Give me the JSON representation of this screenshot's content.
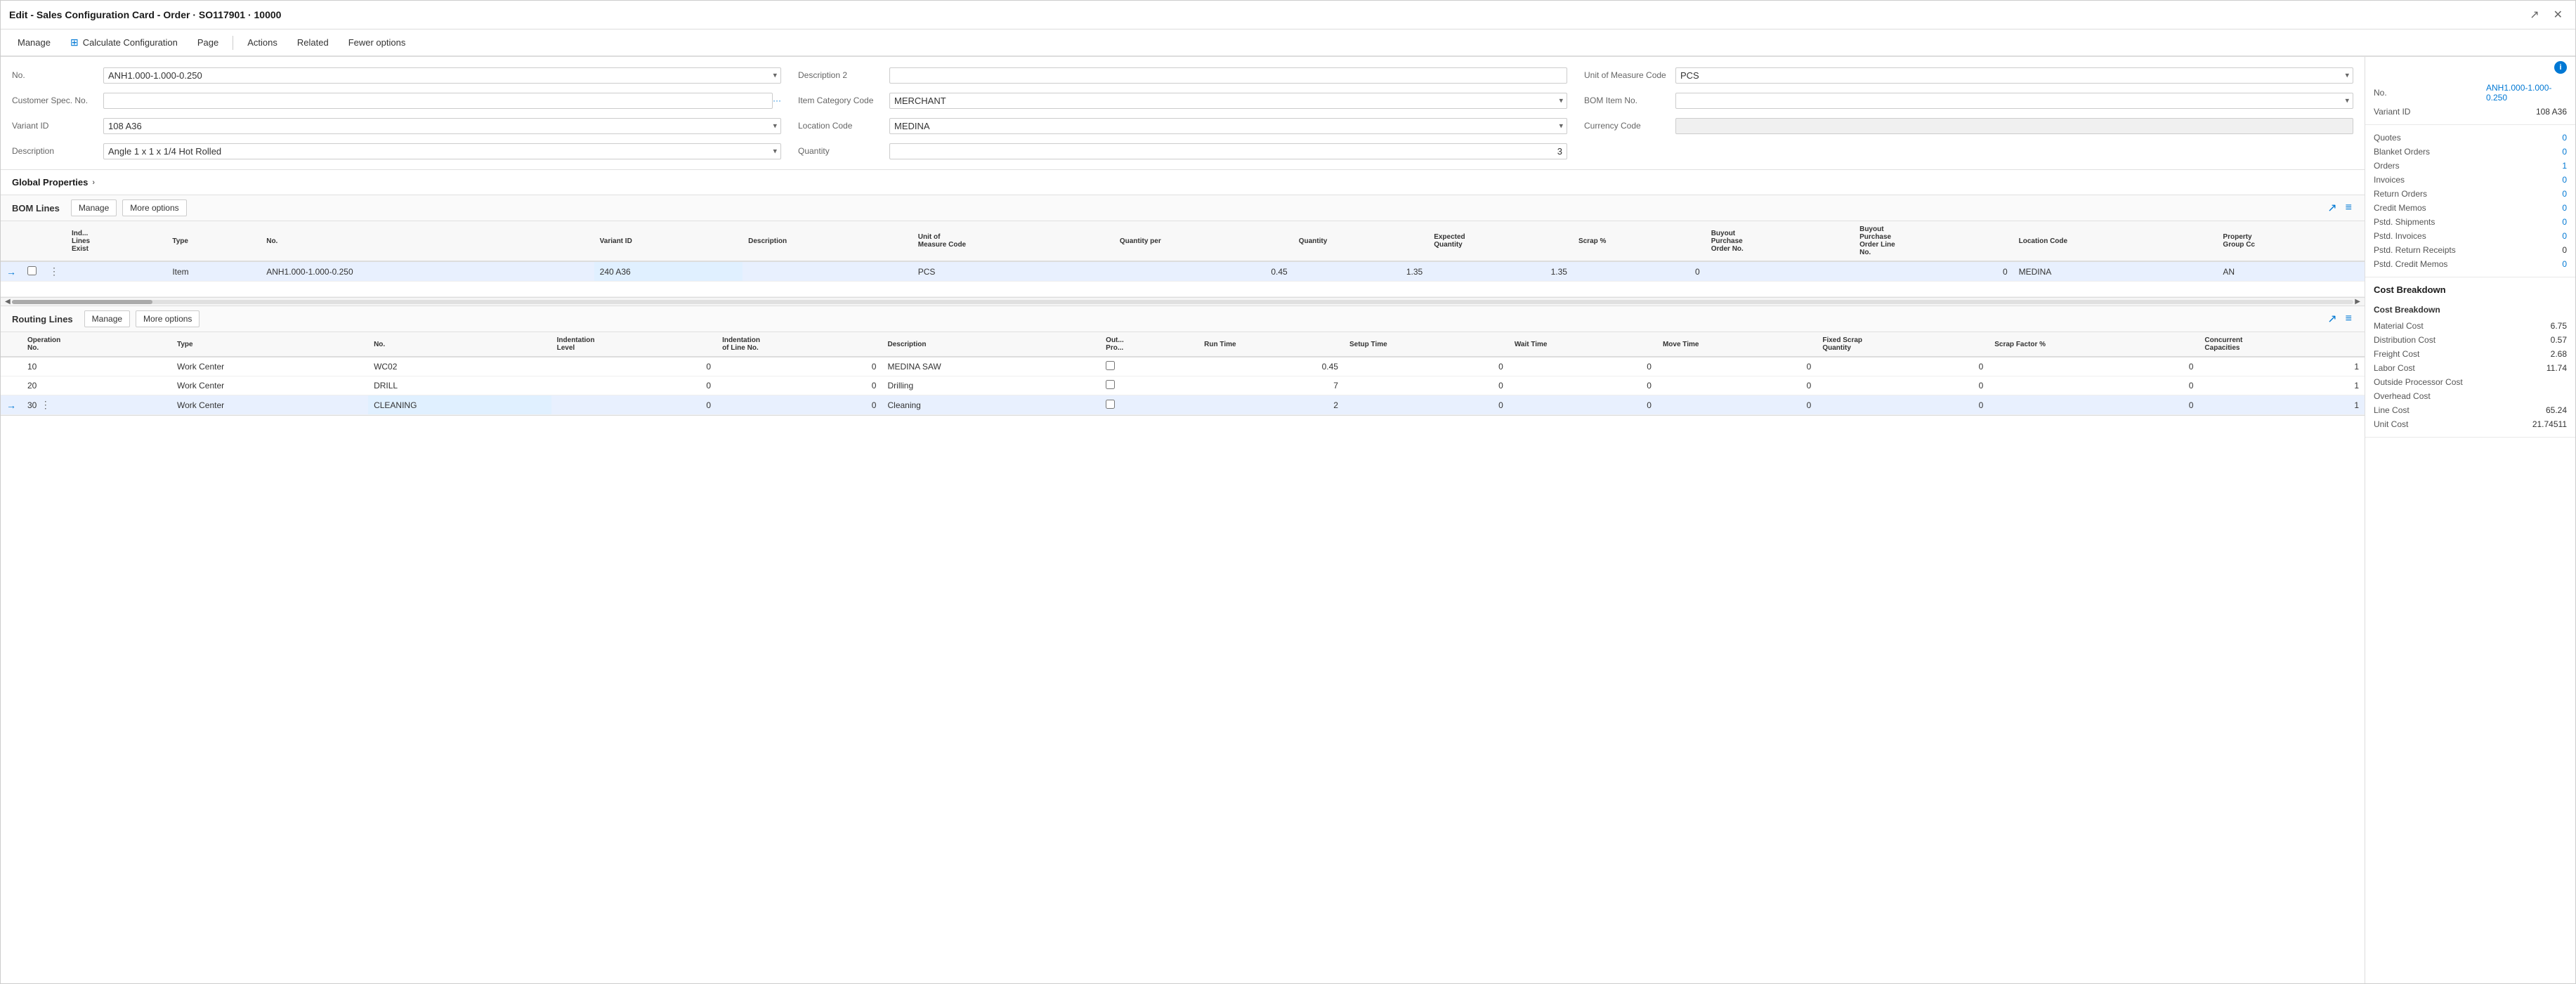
{
  "window": {
    "title": "Edit - Sales Configuration Card - Order · SO117901 · 10000"
  },
  "menu": {
    "items": [
      {
        "id": "manage",
        "label": "Manage",
        "icon": null
      },
      {
        "id": "calculate",
        "label": "Calculate Configuration",
        "icon": "grid"
      },
      {
        "id": "page",
        "label": "Page",
        "icon": null
      },
      {
        "id": "actions",
        "label": "Actions",
        "icon": null
      },
      {
        "id": "related",
        "label": "Related",
        "icon": null
      },
      {
        "id": "fewer",
        "label": "Fewer options",
        "icon": null
      }
    ]
  },
  "form": {
    "fields": {
      "no": {
        "label": "No.",
        "value": "ANH1.000-1.000-0.250",
        "type": "select"
      },
      "description2": {
        "label": "Description 2",
        "value": "",
        "type": "input"
      },
      "unitOfMeasureCode": {
        "label": "Unit of Measure Code",
        "value": "PCS",
        "type": "select"
      },
      "customerSpecNo": {
        "label": "Customer Spec. No.",
        "value": "",
        "type": "input-dots"
      },
      "itemCategoryCode": {
        "label": "Item Category Code",
        "value": "MERCHANT",
        "type": "select"
      },
      "bomItemNo": {
        "label": "BOM Item No.",
        "value": "",
        "type": "select"
      },
      "variantId": {
        "label": "Variant ID",
        "value": "108 A36",
        "type": "select"
      },
      "locationCode": {
        "label": "Location Code",
        "value": "MEDINA",
        "type": "select"
      },
      "currencyCode": {
        "label": "Currency Code",
        "value": "",
        "type": "select-disabled"
      },
      "description": {
        "label": "Description",
        "value": "Angle 1 x 1 x 1/4 Hot Rolled",
        "type": "select"
      },
      "quantity": {
        "label": "Quantity",
        "value": "3",
        "type": "input"
      }
    }
  },
  "globalProperties": {
    "label": "Global Properties"
  },
  "bomLines": {
    "title": "BOM Lines",
    "toolbar": {
      "manage": "Manage",
      "moreOptions": "More options"
    },
    "columns": [
      {
        "id": "ind-lines-exist",
        "label": "Ind...\nLines\nExist"
      },
      {
        "id": "type",
        "label": "Type"
      },
      {
        "id": "no",
        "label": "No."
      },
      {
        "id": "variant-id",
        "label": "Variant ID"
      },
      {
        "id": "description",
        "label": "Description"
      },
      {
        "id": "unit-measure",
        "label": "Unit of\nMeasure Code"
      },
      {
        "id": "qty-per",
        "label": "Quantity per"
      },
      {
        "id": "quantity",
        "label": "Quantity"
      },
      {
        "id": "expected-qty",
        "label": "Expected\nQuantity"
      },
      {
        "id": "scrap-pct",
        "label": "Scrap %"
      },
      {
        "id": "buyout-purchase-order-no",
        "label": "Buyout\nPurchase\nOrder No."
      },
      {
        "id": "buyout-purchase-order-line-no",
        "label": "Buyout\nPurchase\nOrder Line\nNo."
      },
      {
        "id": "location-code",
        "label": "Location Code"
      },
      {
        "id": "property-group-cc",
        "label": "Property\nGroup Cc"
      }
    ],
    "rows": [
      {
        "arrow": "→",
        "checkbox": false,
        "menu": "⋮",
        "indLinesExist": "",
        "type": "Item",
        "no": "ANH1.000-1.000-0.250",
        "variantId": "240 A36",
        "description": "",
        "unitMeasure": "PCS",
        "qtyPer": "0.45",
        "quantity": "1.35",
        "expectedQty": "1.35",
        "scrapPct": "0",
        "buyoutPurchaseOrderNo": "",
        "buyoutPurchaseOrderLineNo": "0",
        "locationCode": "MEDINA",
        "propertyGroupCc": "AN"
      }
    ]
  },
  "routingLines": {
    "title": "Routing Lines",
    "toolbar": {
      "manage": "Manage",
      "moreOptions": "More options"
    },
    "columns": [
      {
        "id": "operation-no",
        "label": "Operation\nNo."
      },
      {
        "id": "type",
        "label": "Type"
      },
      {
        "id": "no",
        "label": "No."
      },
      {
        "id": "indentation-level",
        "label": "Indentation\nLevel"
      },
      {
        "id": "indentation-line-no",
        "label": "Indentation\nof Line No."
      },
      {
        "id": "description",
        "label": "Description"
      },
      {
        "id": "out-pro",
        "label": "Out...\nPro..."
      },
      {
        "id": "run-time",
        "label": "Run Time"
      },
      {
        "id": "setup-time",
        "label": "Setup Time"
      },
      {
        "id": "wait-time",
        "label": "Wait Time"
      },
      {
        "id": "move-time",
        "label": "Move Time"
      },
      {
        "id": "fixed-scrap-qty",
        "label": "Fixed Scrap\nQuantity"
      },
      {
        "id": "scrap-factor-pct",
        "label": "Scrap Factor %"
      },
      {
        "id": "concurrent-capacities",
        "label": "Concurrent\nCapacities"
      }
    ],
    "rows": [
      {
        "arrow": "",
        "operationNo": "10",
        "type": "Work Center",
        "no": "WC02",
        "indentationLevel": "0",
        "indentationLineNo": "0",
        "description": "MEDINA SAW",
        "outPro": false,
        "runTime": "0.45",
        "setupTime": "0",
        "waitTime": "0",
        "moveTime": "0",
        "fixedScrapQty": "0",
        "scrapFactorPct": "0",
        "concurrentCapacities": "1"
      },
      {
        "arrow": "",
        "operationNo": "20",
        "type": "Work Center",
        "no": "DRILL",
        "indentationLevel": "0",
        "indentationLineNo": "0",
        "description": "Drilling",
        "outPro": false,
        "runTime": "7",
        "setupTime": "0",
        "waitTime": "0",
        "moveTime": "0",
        "fixedScrapQty": "0",
        "scrapFactorPct": "0",
        "concurrentCapacities": "1"
      },
      {
        "arrow": "→",
        "menu": "⋮",
        "operationNo": "30",
        "type": "Work Center",
        "no": "CLEANING",
        "indentationLevel": "0",
        "indentationLineNo": "0",
        "description": "Cleaning",
        "outPro": false,
        "runTime": "2",
        "setupTime": "0",
        "waitTime": "0",
        "moveTime": "0",
        "fixedScrapQty": "0",
        "scrapFactorPct": "0",
        "concurrentCapacities": "1"
      }
    ]
  },
  "rightPanel": {
    "no": {
      "label": "No.",
      "value": "ANH1.000-1.000-0.250"
    },
    "variantId": {
      "label": "Variant ID",
      "value": "108 A36"
    },
    "quotes": {
      "label": "Quotes",
      "value": "0"
    },
    "blanketOrders": {
      "label": "Blanket Orders",
      "value": "0"
    },
    "orders": {
      "label": "Orders",
      "value": "1"
    },
    "invoices": {
      "label": "Invoices",
      "value": "0"
    },
    "returnOrders": {
      "label": "Return Orders",
      "value": "0"
    },
    "creditMemos": {
      "label": "Credit Memos",
      "value": "0"
    },
    "pstdShipments": {
      "label": "Pstd. Shipments",
      "value": "0"
    },
    "pstdInvoices": {
      "label": "Pstd. Invoices",
      "value": "0"
    },
    "pstdReturnReceipts": {
      "label": "Pstd. Return Receipts",
      "value": "0"
    },
    "pstdCreditMemos": {
      "label": "Pstd. Credit Memos",
      "value": "0"
    },
    "costBreakdown": {
      "title": "Cost Breakdown",
      "subtitle": "Cost Breakdown",
      "materialCost": {
        "label": "Material Cost",
        "value": "6.75"
      },
      "distributionCost": {
        "label": "Distribution Cost",
        "value": "0.57"
      },
      "freightCost": {
        "label": "Freight Cost",
        "value": "2.68"
      },
      "laborCost": {
        "label": "Labor Cost",
        "value": "11.74"
      },
      "outsideProcessorCost": {
        "label": "Outside Processor Cost",
        "value": ""
      },
      "overheadCost": {
        "label": "Overhead Cost",
        "value": ""
      },
      "lineCost": {
        "label": "Line Cost",
        "value": "65.24"
      },
      "unitCost": {
        "label": "Unit Cost",
        "value": "21.74511"
      }
    }
  }
}
